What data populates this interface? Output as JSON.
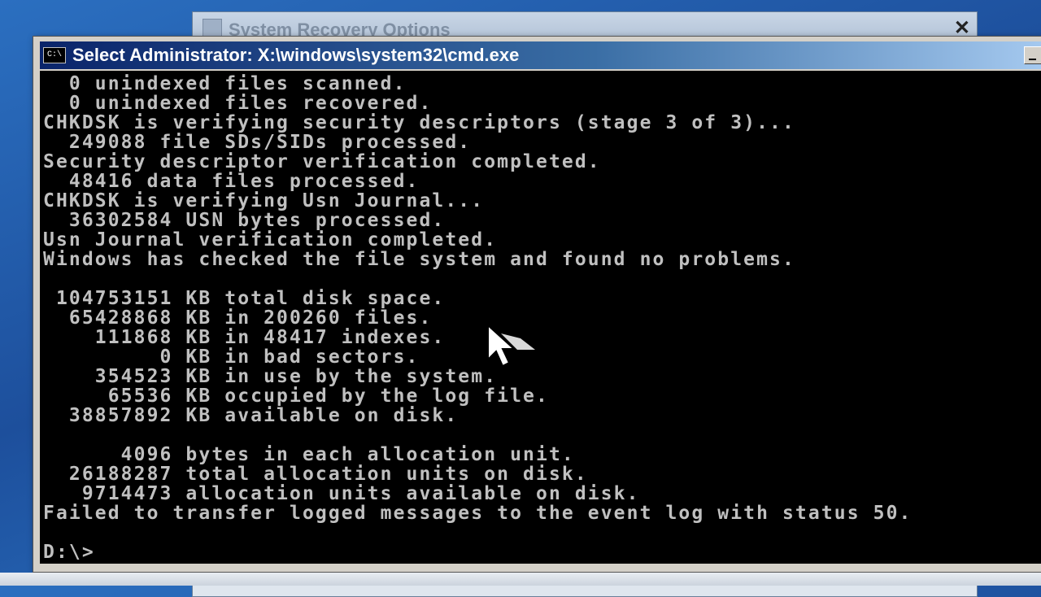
{
  "background_window": {
    "title": "System Recovery Options",
    "close_glyph": "✕"
  },
  "cmd_window": {
    "title": "Select Administrator: X:\\windows\\system32\\cmd.exe",
    "icon_text": "C:\\",
    "icon": "cmd-icon"
  },
  "console": {
    "lines": [
      "  0 unindexed files scanned.",
      "  0 unindexed files recovered.",
      "CHKDSK is verifying security descriptors (stage 3 of 3)...",
      "  249088 file SDs/SIDs processed.",
      "Security descriptor verification completed.",
      "  48416 data files processed.",
      "CHKDSK is verifying Usn Journal...",
      "  36302584 USN bytes processed.",
      "Usn Journal verification completed.",
      "Windows has checked the file system and found no problems.",
      "",
      " 104753151 KB total disk space.",
      "  65428868 KB in 200260 files.",
      "    111868 KB in 48417 indexes.",
      "         0 KB in bad sectors.",
      "    354523 KB in use by the system.",
      "     65536 KB occupied by the log file.",
      "  38857892 KB available on disk.",
      "",
      "      4096 bytes in each allocation unit.",
      "  26188287 total allocation units on disk.",
      "   9714473 allocation units available on disk.",
      "Failed to transfer logged messages to the event log with status 50.",
      "",
      "D:\\>"
    ]
  },
  "colors": {
    "console_bg": "#000000",
    "console_fg": "#c0c0c0",
    "titlebar_start": "#0a246a"
  }
}
